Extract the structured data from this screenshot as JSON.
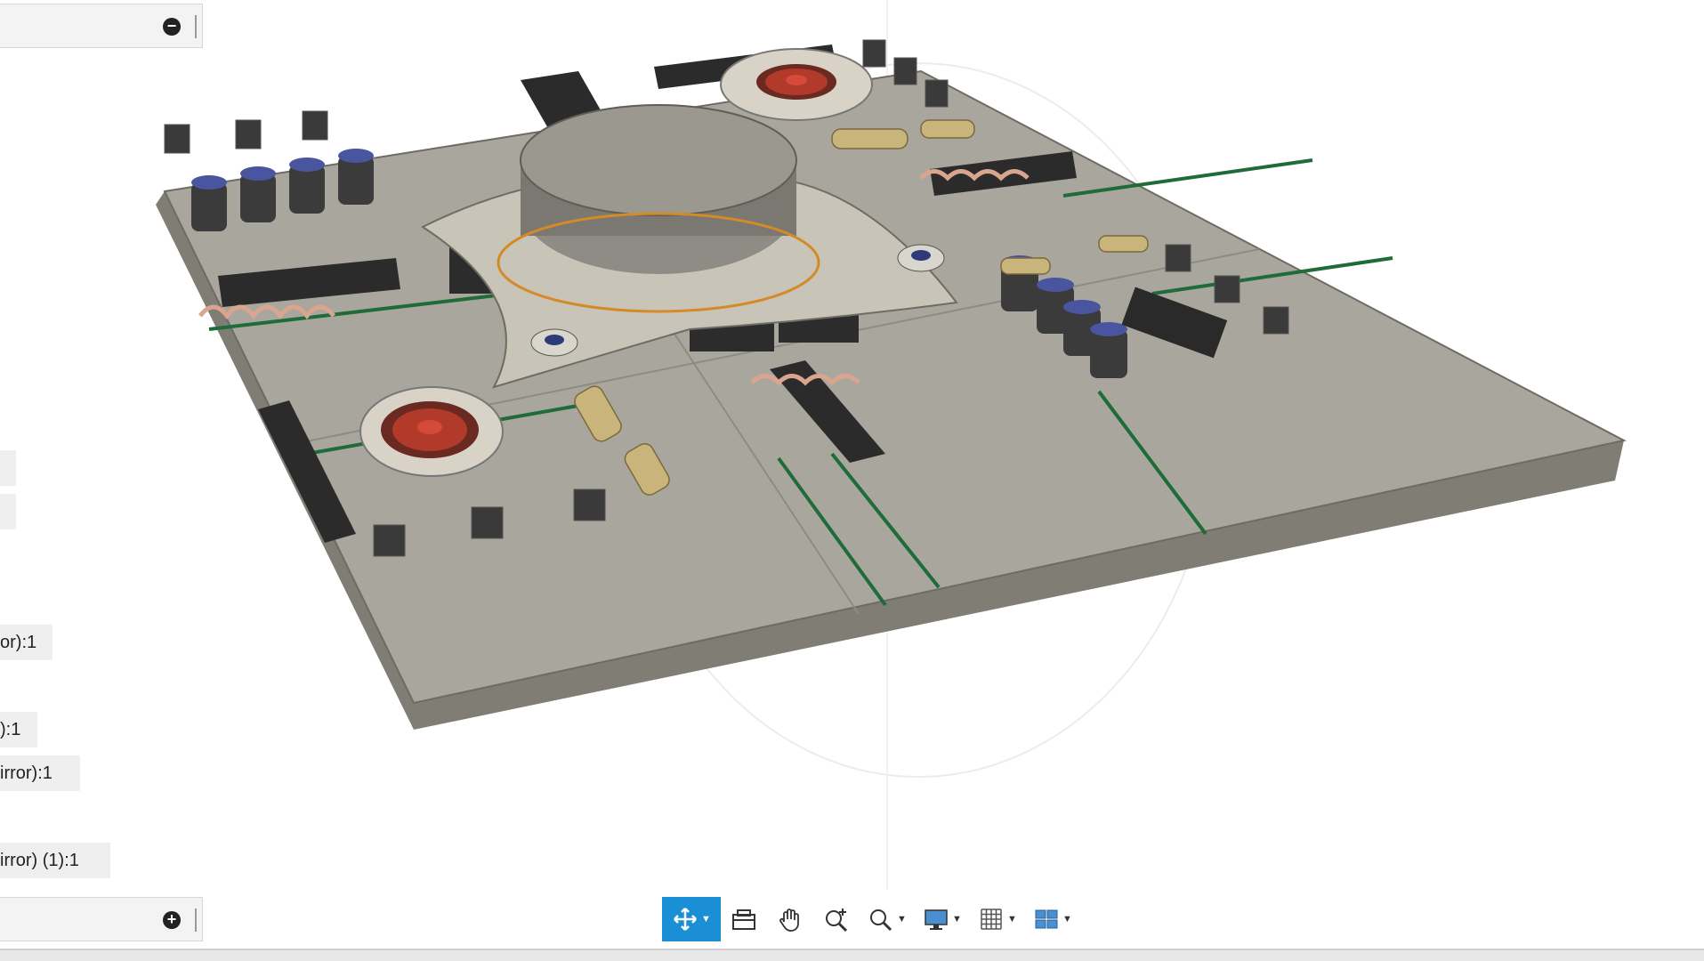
{
  "browser_panel": {
    "collapse_symbol": "−",
    "items": [
      "or):1",
      "):1",
      "irror):1",
      "irror) (1):1"
    ]
  },
  "comments_panel": {
    "expand_symbol": "+"
  },
  "toolbar": {
    "buttons": [
      "orbit-icon",
      "look-at-icon",
      "pan-icon",
      "zoom-window-icon",
      "fit-zoom-icon",
      "display-settings-icon",
      "grid-icon",
      "viewports-icon"
    ],
    "active": "orbit-icon",
    "accent": "#1a8fd6"
  },
  "colors": {
    "plate": "#a7a59b",
    "edge": "#7f7d74",
    "accent_green": "#1f6b3a",
    "fan_red": "#b23a2a",
    "brass": "#c9b47c",
    "copper": "#d9a58f"
  }
}
